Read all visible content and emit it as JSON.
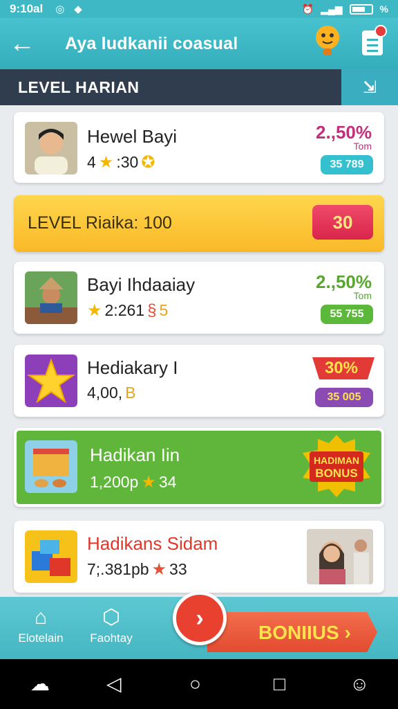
{
  "status_bar": {
    "time": "9:10al",
    "battery_text": "%"
  },
  "app_bar": {
    "title": "Aya ludkanii coasual"
  },
  "section": {
    "title": "LEVEL HARIAN"
  },
  "cards": [
    {
      "name": "Hewel Bayi",
      "stat": "4",
      "stat2": ":30",
      "percent": "2.,50%",
      "unit": "Tom",
      "pill": "35 789",
      "pill_color": "#35c0cf",
      "percent_color": "#c0307c"
    },
    {
      "name": "Bayi Ihdaaiay",
      "stat": "2:261",
      "stat2": "5",
      "percent": "2.,50%",
      "unit": "Tom",
      "pill": "55 755",
      "pill_color": "#5cb83a",
      "percent_color": "#58a531"
    },
    {
      "name": "Hediakary I",
      "stat": "4,00,",
      "stat2": "B",
      "badge": "30%",
      "pill": "35 005",
      "pill_color": "#8a4bb3"
    },
    {
      "name": "Hadikan Iin",
      "stat": "1,200p",
      "stat2": "34",
      "bonus_line1": "HADIMAN",
      "bonus_line2": "BONUS"
    },
    {
      "name": "Hadikans Sidam",
      "stat": "7;.381pb",
      "stat2": "33"
    }
  ],
  "level_bar": {
    "label": "LEVEL",
    "text": "Riaika: 100",
    "badge": "30"
  },
  "bottom_nav": {
    "items": [
      {
        "label": "Elotelain",
        "icon": "home-icon"
      },
      {
        "label": "Faohtay",
        "icon": "shield-icon"
      }
    ],
    "bonus_label": "BONIIUS"
  },
  "colors": {
    "teal": "#3fb8c6",
    "dark": "#2f3d4f",
    "yellow": "#f9c23c",
    "green": "#5fb63a",
    "red": "#e8412f"
  }
}
